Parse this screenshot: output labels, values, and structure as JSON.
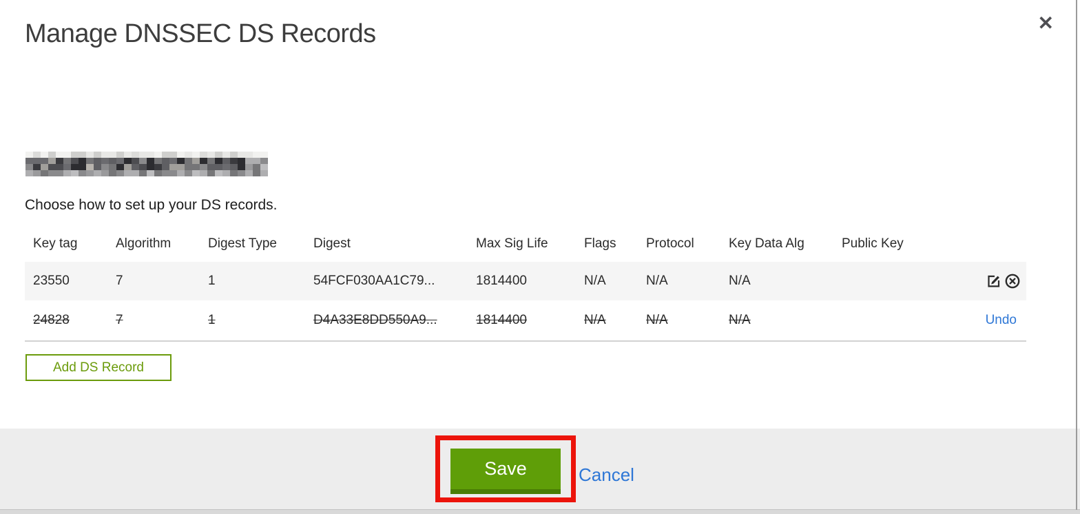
{
  "modal": {
    "title": "Manage DNSSEC DS Records",
    "close_glyph": "✕"
  },
  "domain": {
    "redacted": true
  },
  "instruction": "Choose how to set up your DS records.",
  "table": {
    "columns": [
      "Key tag",
      "Algorithm",
      "Digest Type",
      "Digest",
      "Max Sig Life",
      "Flags",
      "Protocol",
      "Key Data Alg",
      "Public Key"
    ],
    "rows": [
      {
        "state": "normal",
        "cells": [
          "23550",
          "7",
          "1",
          "54FCF030AA1C79...",
          "1814400",
          "N/A",
          "N/A",
          "N/A",
          ""
        ],
        "actions": [
          "edit-icon",
          "delete-circle-icon"
        ]
      },
      {
        "state": "deleted",
        "cells": [
          "24828",
          "7",
          "1",
          "D4A33E8DD550A9...",
          "1814400",
          "N/A",
          "N/A",
          "N/A",
          ""
        ],
        "action_label": "Undo"
      }
    ]
  },
  "buttons": {
    "add_ds_record": "Add DS Record",
    "save": "Save",
    "cancel": "Cancel"
  },
  "annotation": {
    "shape": "red-rectangle",
    "target": "save-button"
  },
  "colors": {
    "accent_green": "#5f9e08",
    "accent_green_dark": "#4a7d06",
    "outline_green": "#6b9b0b",
    "link_blue": "#2e77d6",
    "annotation_red": "#ec140b",
    "row_alt_gray": "#f5f5f5",
    "footer_gray": "#ededed"
  },
  "redaction_palette": {
    "top": [
      "#e8e8e6",
      "#dcdcda",
      "#f2f2f0",
      "#cfcfcd"
    ],
    "mid": [
      "#3a3a3e",
      "#4d4d51",
      "#5f5f63",
      "#757577",
      "#8a8a8c",
      "#2c2c30",
      "#a19f9b",
      "#6b6b6f",
      "#b8b4ae"
    ],
    "bottom": [
      "#9a9a9c",
      "#8a8a8c",
      "#aeaeb0",
      "#bdbdbf",
      "#767678"
    ]
  }
}
